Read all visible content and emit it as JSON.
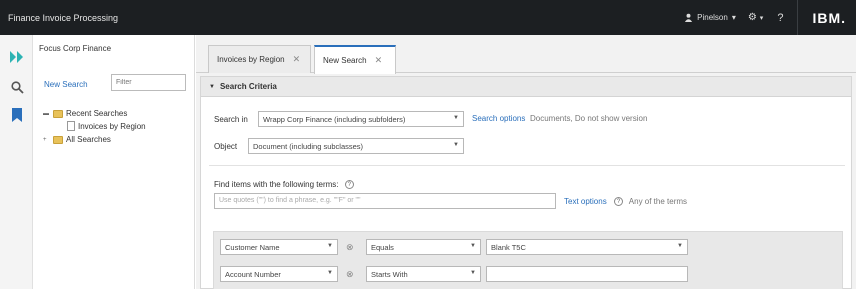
{
  "app": {
    "title": "Finance Invoice Processing"
  },
  "topbar": {
    "user_label": "Pinelson",
    "ibm_logo": "IBM."
  },
  "left_panel": {
    "title": "Focus Corp Finance",
    "new_search_label": "New Search",
    "filter_placeholder": "Filter",
    "tree": [
      {
        "label": "Recent Searches",
        "expanded": true
      },
      {
        "label": "Invoices by Region",
        "child": true
      },
      {
        "label": "All Searches",
        "expanded": false
      }
    ]
  },
  "tabs": [
    {
      "label": "Invoices by Region"
    },
    {
      "label": "New Search",
      "active": true
    }
  ],
  "search": {
    "section_title": "Search Criteria",
    "search_in_label": "Search in",
    "search_in_value": "Wrapp Corp Finance (including subfolders)",
    "search_options_link": "Search options",
    "search_options_tail": "Documents, Do not show version",
    "object_label": "Object",
    "object_value": "Document (including subclasses)",
    "find_items_label": "Find items with the following terms:",
    "terms_placeholder": "Use quotes (\"\") to find a phrase, e.g. \"\"F\" or \"\"",
    "text_options_link": "Text options",
    "any_terms_label": "Any of the terms",
    "criteria": [
      {
        "property": "Customer Name",
        "operator": "Equals",
        "value": "Blank T5C"
      },
      {
        "property": "Account Number",
        "operator": "Starts With",
        "value": ""
      }
    ]
  }
}
